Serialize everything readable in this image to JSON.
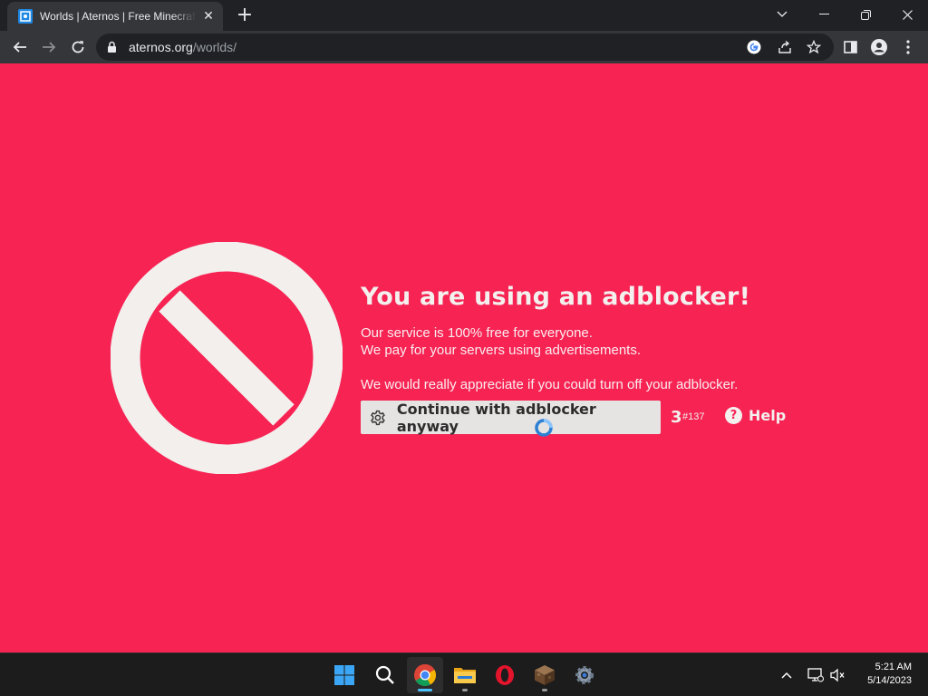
{
  "browser": {
    "tab": {
      "title": "Worlds | Aternos | Free Minecraft Server",
      "close_glyph": "✕"
    },
    "new_tab_glyph": "+",
    "address": {
      "host": "aternos.org",
      "path": "/worlds/"
    }
  },
  "page": {
    "headline": "You are using an adblocker!",
    "lines": [
      "Our service is 100% free for everyone.",
      "We pay for your servers using advertisements.",
      "We would really appreciate if you could turn off your adblocker."
    ],
    "continue_button": "Continue with adblocker anyway",
    "countdown": "3",
    "counter_id": "#137",
    "help_icon_glyph": "?",
    "help_label": "Help"
  },
  "taskbar": {
    "apps": [
      "start",
      "search",
      "chrome",
      "file-explorer",
      "opera",
      "minecraft",
      "settings"
    ],
    "active_app": "chrome",
    "time": "5:21 AM",
    "date": "5/14/2023"
  },
  "colors": {
    "page_background": "#f62353",
    "button_background": "#e6e4e3",
    "chrome_dark": "#202124",
    "chrome_toolbar": "#35363a"
  }
}
